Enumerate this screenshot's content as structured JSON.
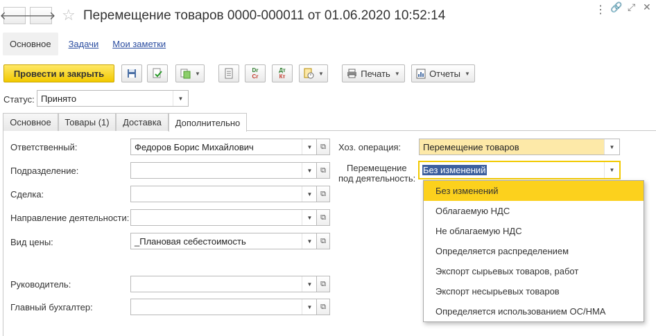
{
  "header": {
    "title": "Перемещение товаров 0000-000011 от 01.06.2020 10:52:14",
    "back_glyph": "🡐",
    "forward_glyph": "🡒"
  },
  "sections": {
    "main": "Основное",
    "tasks": "Задачи",
    "notes": "Мои заметки"
  },
  "toolbar": {
    "post_close": "Провести и закрыть",
    "print": "Печать",
    "reports": "Отчеты",
    "dt_kt_top": "Дт",
    "dt_kt_bottom": "Кт",
    "dr_cr_top": "Dr",
    "dr_cr_bottom": "Cr"
  },
  "status": {
    "label": "Статус:",
    "value": "Принято"
  },
  "tabs": [
    {
      "label": "Основное"
    },
    {
      "label": "Товары (1)"
    },
    {
      "label": "Доставка"
    },
    {
      "label": "Дополнительно"
    }
  ],
  "form": {
    "responsible": {
      "label": "Ответственный:",
      "value": "Федоров Борис Михайлович"
    },
    "department": {
      "label": "Подразделение:",
      "value": ""
    },
    "deal": {
      "label": "Сделка:",
      "value": ""
    },
    "direction": {
      "label": "Направление деятельности:",
      "value": ""
    },
    "price_type": {
      "label": "Вид цены:",
      "value": "_Плановая себестоимость"
    },
    "manager": {
      "label": "Руководитель:",
      "value": ""
    },
    "chief_accountant": {
      "label": "Главный бухгалтер:",
      "value": ""
    },
    "operation": {
      "label": "Хоз. операция:",
      "value": "Перемещение товаров"
    },
    "activity_move": {
      "label_line1": "Перемещение",
      "label_line2": "под деятельность:",
      "value": "Без изменений"
    }
  },
  "dropdown": {
    "options": [
      "Без изменений",
      "Облагаемую НДС",
      "Не облагаемую НДС",
      "Определяется распределением",
      "Экспорт сырьевых товаров, работ",
      "Экспорт несырьевых товаров",
      "Определяется использованием ОС/НМА"
    ],
    "selected_index": 0
  },
  "colors": {
    "accent_yellow": "#fcd11d",
    "link_blue": "#2b4da0",
    "highlight_field": "#fde9a8"
  }
}
